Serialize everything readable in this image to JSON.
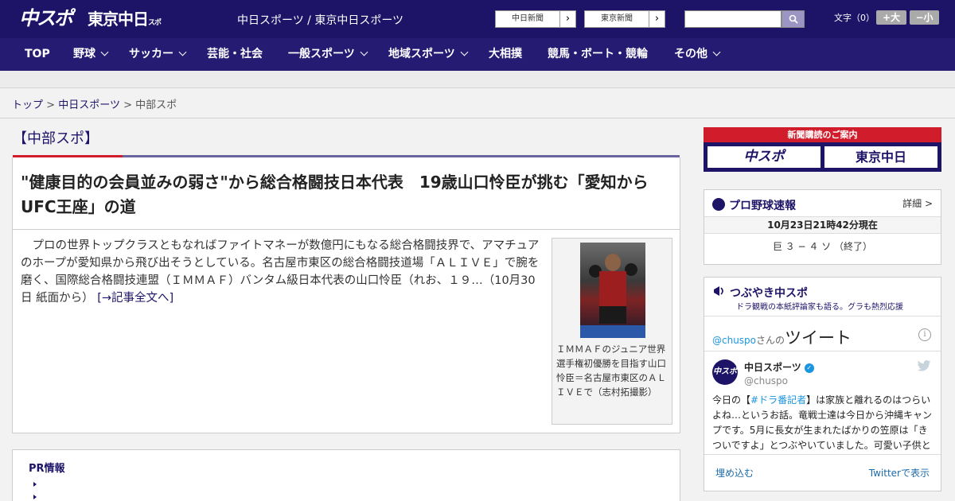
{
  "header": {
    "logo_chuspo": "中スポ",
    "logo_tokyo": "東京中日",
    "logo_tokyo_small": "スポーツ",
    "site_title": "中日スポーツ / 東京中日スポーツ",
    "link_chunichi": "中日新聞",
    "link_tokyo": "東京新聞",
    "arrow": "›",
    "search_placeholder": "",
    "font_label": "文字（0）",
    "font_bigger": "+大",
    "font_smaller": "−小"
  },
  "nav": {
    "items": [
      {
        "label": "TOP"
      },
      {
        "label": "野球"
      },
      {
        "label": "サッカー"
      },
      {
        "label": "芸能・社会"
      },
      {
        "label": "一般スポーツ"
      },
      {
        "label": "地域スポーツ"
      },
      {
        "label": "大相撲"
      },
      {
        "label": "競馬・ボート・競輪"
      },
      {
        "label": "その他"
      }
    ]
  },
  "breadcrumb": {
    "top": "トップ",
    "sep": ">",
    "chunichi": "中日スポーツ",
    "current": "中部スポ"
  },
  "article": {
    "category": "【中部スポ】",
    "headline": "\"健康目的の会員並みの弱さ\"から総合格闘技日本代表　19歳山口怜臣が挑む「愛知からUFC王座」の道",
    "body": "　プロの世界トップクラスともなればファイトマネーが数億円にもなる総合格闘技界で、アマチュアのホープが愛知県から飛び出そうとしている。名古屋市東区の総合格闘技道場「ＡＬＩＶＥ」で腕を磨く、国際総合格闘技連盟（ＩＭＭＡＦ）バンタム級日本代表の山口怜臣（れお、１９…（10月30日 紙面から）",
    "read_more": "[→記事全文へ]",
    "caption": "ＩＭＭＡＦのジュニア世界選手権初優勝を目指す山口怜臣＝名古屋市東区のＡＬＩＶＥで（志村拓撮影）"
  },
  "pr": {
    "title": "PR情報"
  },
  "sidebar": {
    "subscribe_title": "新聞購読のご案内",
    "subscribe_chuspo": "中スポ",
    "subscribe_tokyo": "東京中日",
    "baseball_title": "プロ野球速報",
    "baseball_detail": "詳細 >",
    "baseball_asof": "10月23日21時42分現在",
    "baseball_score": "巨 ３ − ４ ソ （終了）",
    "tweet_title": "つぶやき中スポ",
    "tweet_sub": "ドラ観戦の本紙評論家も語る。グラも熱烈応援",
    "tweet_handle": "@chuspo",
    "tweet_san": "さんの",
    "tweet_word": "ツイート",
    "tweet_info": "i",
    "tweet_avatar": "中スポ",
    "tweet_name": "中日スポーツ",
    "tweet_verified": "✓",
    "tweet_user": "@chuspo",
    "tweet_text_pre": "今日の【",
    "tweet_tag": "#ドラ番記者",
    "tweet_text_post": "】は家族と離れるのはつらいよね…というお話。竜戦士達は今日から沖縄キャンプです。5月に長女が生まれたばかりの笠原は「きついですよ」とつぶやいていました。可愛い子供と",
    "tweet_embed": "埋め込む",
    "tweet_view": "Twitterで表示"
  }
}
